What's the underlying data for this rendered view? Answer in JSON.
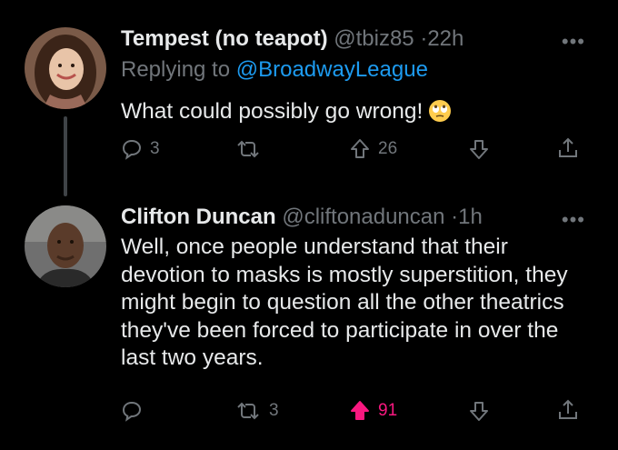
{
  "tweets": [
    {
      "name": "Tempest (no teapot)",
      "handle": "@tbiz85",
      "separator": "·",
      "time": "22h",
      "more": "•••",
      "replying_prefix": "Replying to",
      "replying_handle": "@BroadwayLeague",
      "text": "What could possibly go wrong!",
      "emoji": "face-with-rolling-eyes-icon",
      "reply_count": "3",
      "retweet_count": "",
      "like_count": "26",
      "liked": false
    },
    {
      "name": "Clifton Duncan",
      "handle": "@cliftonaduncan",
      "separator": "·",
      "time": "1h",
      "more": "•••",
      "text": "Well, once people understand that their devotion to masks is mostly superstition, they might begin to question all the other theatrics they've been forced to participate in over the last two years.",
      "reply_count": "",
      "retweet_count": "3",
      "like_count": "91",
      "liked": true
    }
  ],
  "colors": {
    "background": "#000000",
    "text": "#e7e9ea",
    "muted": "#71767b",
    "link": "#1d9bf0",
    "like": "#f91880"
  }
}
